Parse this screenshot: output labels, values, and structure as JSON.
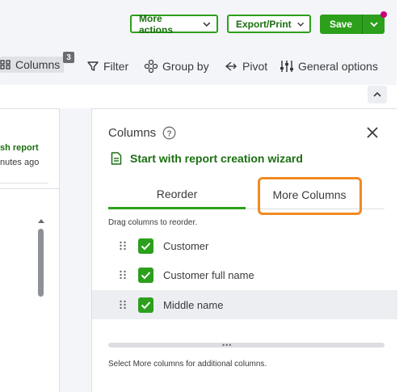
{
  "header": {
    "more_actions_label": "More actions",
    "export_print_label": "Export/Print",
    "save_label": "Save"
  },
  "toolbar": {
    "columns_label": "Columns",
    "columns_count": "3",
    "filter_label": "Filter",
    "group_by_label": "Group by",
    "pivot_label": "Pivot",
    "general_options_label": "General options"
  },
  "background_report": {
    "refresh_link": "sh report",
    "refresh_time": "nutes ago"
  },
  "columns_panel": {
    "title": "Columns",
    "wizard_link": "Start with report creation wizard",
    "tabs": [
      {
        "label": "Reorder",
        "active": true
      },
      {
        "label": "More Columns",
        "active": false
      }
    ],
    "hint": "Drag columns to reorder.",
    "columns": [
      {
        "label": "Customer",
        "checked": true
      },
      {
        "label": "Customer full name",
        "checked": true
      },
      {
        "label": "Middle name",
        "checked": true
      }
    ],
    "footer_note": "Select More columns for additional columns."
  },
  "colors": {
    "brand_green": "#2ca01c",
    "dark_green_text": "#1b6f11",
    "highlight_orange": "#f08a24",
    "notification_dot": "#c9007a"
  }
}
